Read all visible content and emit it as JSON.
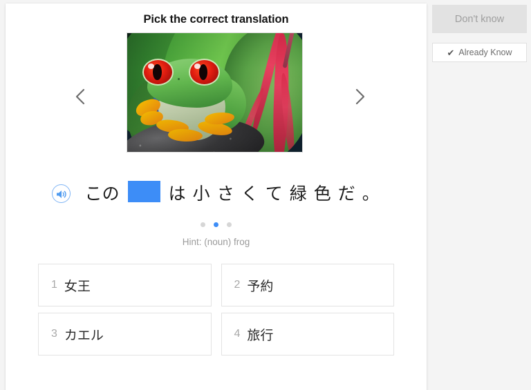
{
  "card": {
    "title": "Pick the correct translation"
  },
  "media": {
    "prev_icon": "chevron-left-icon",
    "next_icon": "chevron-right-icon",
    "image_alt": "red-eyed tree frog on mossy rock with green and red leaves"
  },
  "sentence": {
    "audio_icon": "speaker-icon",
    "tokens": [
      "この",
      "",
      "は",
      "小",
      "さ",
      "く",
      "て",
      "緑",
      "色",
      "だ",
      "。"
    ],
    "blank_index": 1,
    "blank_color": "#3d8df7",
    "t0": "この",
    "t2": "は",
    "t3": "小",
    "t4": "さ",
    "t5": "く",
    "t6": "て",
    "t7": "緑",
    "t8": "色",
    "t9": "だ",
    "t10": "。"
  },
  "pagination": {
    "total": 3,
    "active_index": 1,
    "active_color": "#3d8df7",
    "inactive_color": "#d6d6d6"
  },
  "hint": {
    "text": "Hint: (noun) frog"
  },
  "options": [
    {
      "num": "1",
      "text": "女王"
    },
    {
      "num": "2",
      "text": "予約"
    },
    {
      "num": "3",
      "text": "カエル"
    },
    {
      "num": "4",
      "text": "旅行"
    }
  ],
  "rail": {
    "dont_know_label": "Don't know",
    "already_know_label": "Already Know",
    "already_know_icon": "check-icon",
    "check_glyph": "✔"
  }
}
